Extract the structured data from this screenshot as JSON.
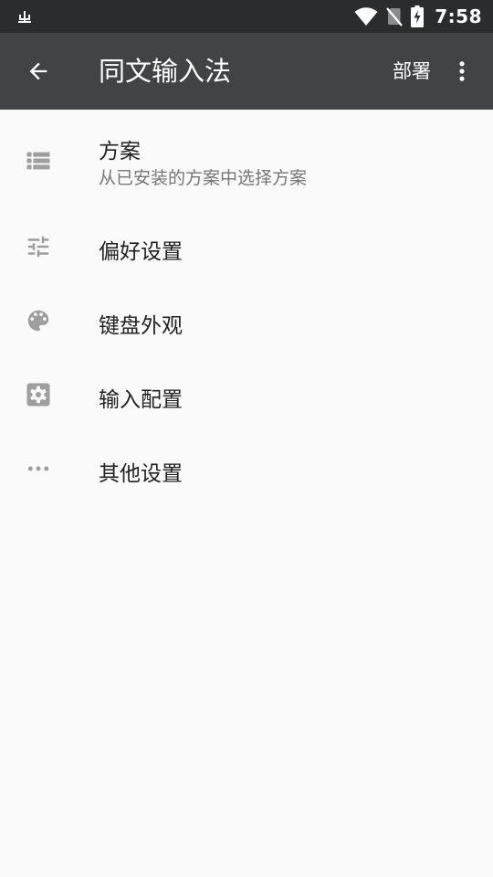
{
  "status_bar": {
    "time": "7:58",
    "notification_icon": "usb-debug-icon",
    "wifi_icon": "wifi-icon",
    "sim_icon": "no-sim-icon",
    "battery_icon": "battery-charging-icon"
  },
  "app_bar": {
    "back_icon": "arrow-back-icon",
    "title": "同文输入法",
    "deploy_label": "部署",
    "overflow_icon": "more-vert-icon",
    "background_color": "#414346"
  },
  "menu": {
    "items": [
      {
        "title": "方案",
        "summary": "从已安装的方案中选择方案",
        "icon": "list-icon"
      },
      {
        "title": "偏好设置",
        "icon": "tune-icon"
      },
      {
        "title": "键盘外观",
        "icon": "palette-icon"
      },
      {
        "title": "输入配置",
        "icon": "settings-box-icon"
      },
      {
        "title": "其他设置",
        "icon": "more-horiz-icon"
      }
    ]
  },
  "colors": {
    "status_bar": "#2b2c2e",
    "app_bar": "#414346",
    "background": "#fafafa",
    "title_text": "#212121",
    "summary_text": "#757575",
    "icon": "#9e9e9e"
  }
}
